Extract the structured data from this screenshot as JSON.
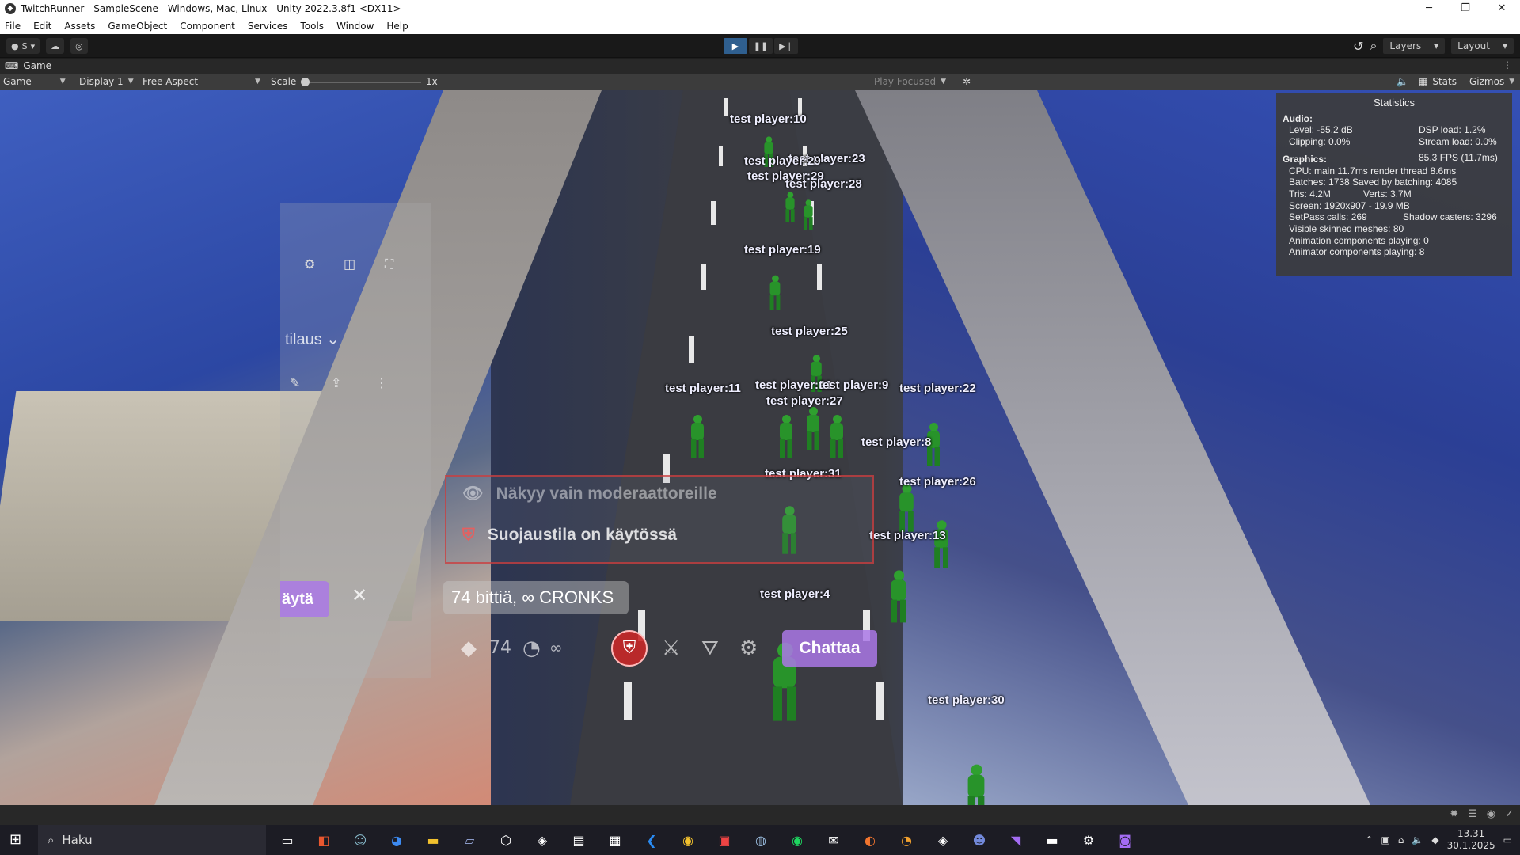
{
  "window": {
    "title": "TwitchRunner - SampleScene - Windows, Mac, Linux - Unity 2022.3.8f1 <DX11>",
    "minimize": "─",
    "maximize": "❐",
    "close": "✕"
  },
  "menu": [
    "File",
    "Edit",
    "Assets",
    "GameObject",
    "Component",
    "Services",
    "Tools",
    "Window",
    "Help"
  ],
  "toolbar": {
    "account": "S",
    "layers": "Layers",
    "layout": "Layout"
  },
  "game_tab": {
    "label": "Game"
  },
  "game_toolbar": {
    "view": "Game",
    "display": "Display 1",
    "aspect": "Free Aspect",
    "scale_label": "Scale",
    "scale_value": "1x",
    "play_focused": "Play Focused",
    "stats": "Stats",
    "gizmos": "Gizmos"
  },
  "stats": {
    "title": "Statistics",
    "audio_header": "Audio:",
    "level": "Level: -55.2 dB",
    "dsp": "DSP load: 1.2%",
    "clipping": "Clipping: 0.0%",
    "stream": "Stream load: 0.0%",
    "graphics_header": "Graphics:",
    "fps": "85.3 FPS (11.7ms)",
    "cpu": "CPU: main 11.7ms  render thread 8.6ms",
    "batches": "Batches: 1738  Saved by batching: 4085",
    "tris": "Tris: 4.2M",
    "verts": "Verts: 3.7M",
    "screen": "Screen: 1920x907 - 19.9 MB",
    "setpass": "SetPass calls: 269",
    "shadow": "Shadow casters: 3296",
    "skinned": "Visible skinned meshes: 80",
    "animation": "Animation components playing: 0",
    "animator": "Animator components playing: 8"
  },
  "players": [
    {
      "label": "test player:10"
    },
    {
      "label": "test player:23"
    },
    {
      "label": "test player:29"
    },
    {
      "label": "test player:28"
    },
    {
      "label": "test player:19"
    },
    {
      "label": "test player:25"
    },
    {
      "label": "test player:11"
    },
    {
      "label": "test player:21"
    },
    {
      "label": "test player:9"
    },
    {
      "label": "test player:27"
    },
    {
      "label": "test player:22"
    },
    {
      "label": "test player:8"
    },
    {
      "label": "test player:31"
    },
    {
      "label": "test player:26"
    },
    {
      "label": "test player:13"
    },
    {
      "label": "test player:4"
    },
    {
      "label": "test player:30"
    }
  ],
  "chat_overlay": {
    "dropdown": "tilaus",
    "use_button": "äytä",
    "moderators_only": "Näkyy vain moderaattoreille",
    "shield_mode": "Suojaustila on käytössä",
    "bits": "74 bittiä, ∞ CRONKS",
    "points": "74",
    "infinity": "∞",
    "chat_button": "Chattaa"
  },
  "taskbar": {
    "search": "Haku",
    "time": "13.31",
    "date": "30.1.2025"
  }
}
